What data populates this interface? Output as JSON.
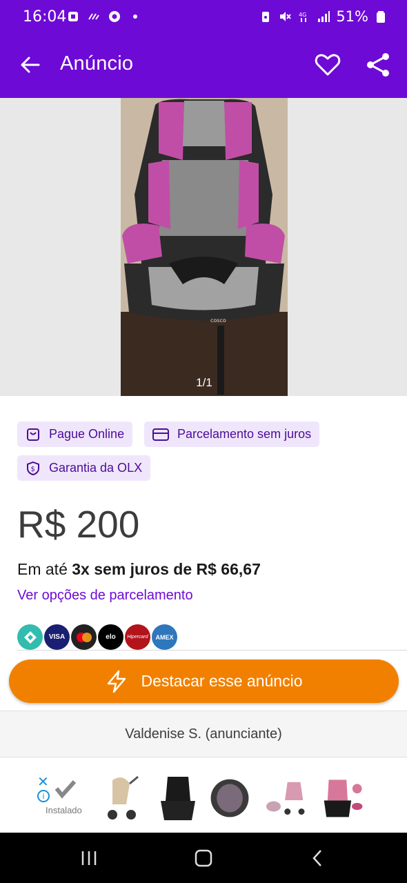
{
  "status_bar": {
    "time": "16:04",
    "battery": "51%"
  },
  "app_bar": {
    "title": "Anúncio"
  },
  "gallery": {
    "counter": "1/1"
  },
  "badges": [
    {
      "label": "Pague Online",
      "icon": "bag-icon"
    },
    {
      "label": "Parcelamento sem juros",
      "icon": "card-icon"
    },
    {
      "label": "Garantia da OLX",
      "icon": "shield-dollar-icon"
    }
  ],
  "price": "R$ 200",
  "installments": {
    "prefix": "Em até",
    "highlight": "3x sem juros de R$ 66,67"
  },
  "options_link": "Ver opções de parcelamento",
  "payments": [
    {
      "name": "pix",
      "label": "",
      "color": "#32bcad"
    },
    {
      "name": "visa",
      "label": "VISA",
      "color": "#1a1f71"
    },
    {
      "name": "mastercard",
      "label": "",
      "color": "#222222"
    },
    {
      "name": "elo",
      "label": "elo",
      "color": "#000000"
    },
    {
      "name": "hipercard",
      "label": "Hipercard",
      "color": "#b3131b"
    },
    {
      "name": "amex",
      "label": "AMEX",
      "color": "#2e77bc"
    }
  ],
  "cta": {
    "label": "Destacar esse anúncio",
    "color": "#f28000"
  },
  "seller": {
    "name": "Valdenise S.",
    "role": "(anunciante)"
  },
  "ad_banner": {
    "installed_label": "Instalado"
  },
  "colors": {
    "brand": "#6e0ad6",
    "badge_bg": "#f0e6fc",
    "badge_text": "#4a0d96"
  }
}
